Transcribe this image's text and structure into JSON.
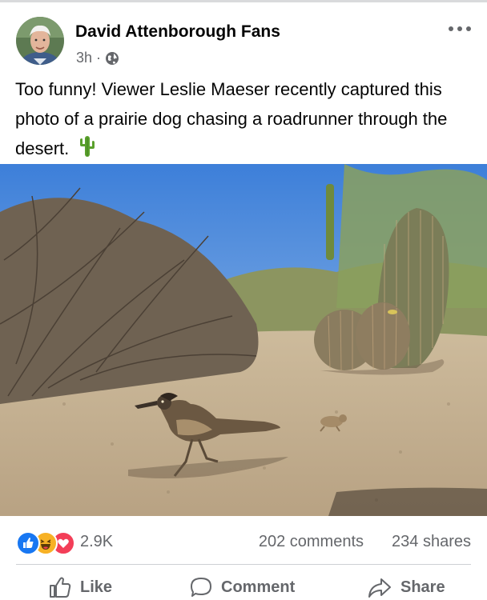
{
  "post": {
    "page_name": "David Attenborough Fans",
    "timestamp": "3h",
    "separator": "·",
    "audience_icon": "globe-icon",
    "caption": "Too funny! Viewer Leslie Maeser recently captured this photo of a prairie dog chasing a roadrunner through the desert.",
    "caption_emoji": "cactus"
  },
  "engagement": {
    "reaction_icons": [
      "like",
      "haha",
      "love"
    ],
    "reaction_count": "2.9K",
    "comments": "202 comments",
    "shares": "234 shares"
  },
  "actions": [
    {
      "label": "Like",
      "icon": "thumbs-up-icon"
    },
    {
      "label": "Comment",
      "icon": "comment-bubble-icon"
    },
    {
      "label": "Share",
      "icon": "share-arrow-icon"
    }
  ],
  "colors": {
    "text": "#050505",
    "secondary": "#65676b",
    "like_blue": "#1877f2",
    "love_red": "#f33e58",
    "haha_yellow": "#f7b125"
  }
}
